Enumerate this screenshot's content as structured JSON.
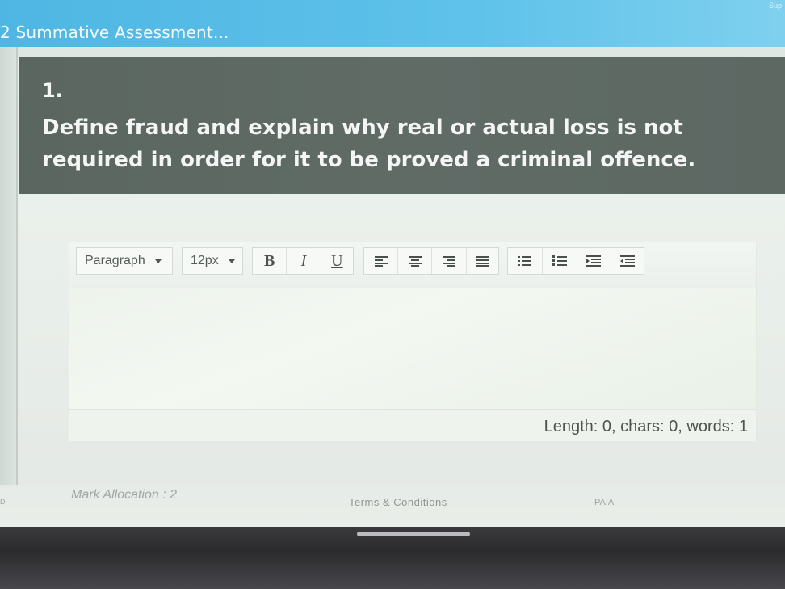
{
  "header": {
    "title": "2 Summative Assessment...",
    "corner_text": "Sup"
  },
  "question": {
    "number": "1.",
    "text": "Define fraud and explain why real or actual loss is not required in order for it to be proved a criminal offence."
  },
  "editor": {
    "block_format": "Paragraph",
    "font_size": "12px",
    "bold_label": "B",
    "italic_label": "I",
    "underline_label": "U",
    "status": "Length: 0, chars: 0, words: 1"
  },
  "icons": {
    "align": [
      "align-left-icon",
      "align-center-icon",
      "align-right-icon",
      "align-justify-icon"
    ],
    "lists": [
      "bullet-list-icon",
      "numbered-list-icon",
      "indent-icon",
      "outdent-icon"
    ]
  },
  "footer": {
    "mark_allocation": "Mark Allocation : 2",
    "terms": "Terms & Conditions",
    "paia": "PAIA",
    "edge": "D"
  }
}
